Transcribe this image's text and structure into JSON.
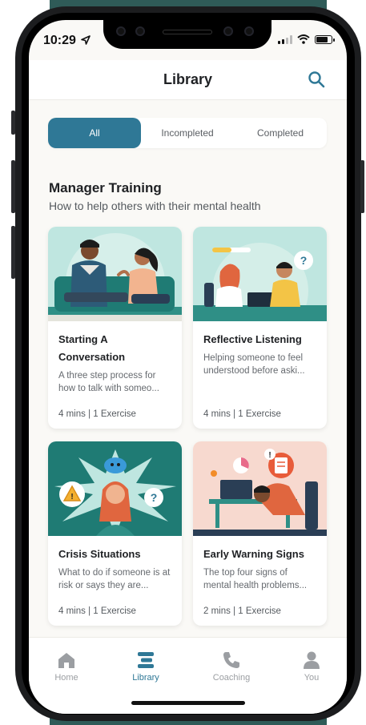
{
  "status": {
    "time": "10:29"
  },
  "header": {
    "title": "Library",
    "search_icon": "search-icon"
  },
  "filter_tabs": [
    {
      "label": "All",
      "active": true
    },
    {
      "label": "Incompleted",
      "active": false
    },
    {
      "label": "Completed",
      "active": false
    }
  ],
  "section": {
    "title": "Manager Training",
    "subtitle": "How to help others with their mental health"
  },
  "cards": [
    {
      "title": "Starting A Conversation",
      "description": "A three step process for how to talk with someo...",
      "meta": "4 mins | 1 Exercise"
    },
    {
      "title": "Reflective Listening",
      "description": "Helping someone to feel understood before aski...",
      "meta": "4 mins | 1 Exercise"
    },
    {
      "title": "Crisis Situations",
      "description": "What to do if someone is at risk or says they are...",
      "meta": "4 mins | 1 Exercise"
    },
    {
      "title": "Early Warning Signs",
      "description": "The top four signs of mental health problems...",
      "meta": "2 mins | 1 Exercise"
    }
  ],
  "tabbar": [
    {
      "label": "Home",
      "icon": "home-icon",
      "active": false
    },
    {
      "label": "Library",
      "icon": "library-icon",
      "active": true
    },
    {
      "label": "Coaching",
      "icon": "phone-icon",
      "active": false
    },
    {
      "label": "You",
      "icon": "person-icon",
      "active": false
    }
  ],
  "colors": {
    "accent": "#2f7896",
    "background": "#faf9f6",
    "inactive_tab": "#9b9ea2"
  }
}
